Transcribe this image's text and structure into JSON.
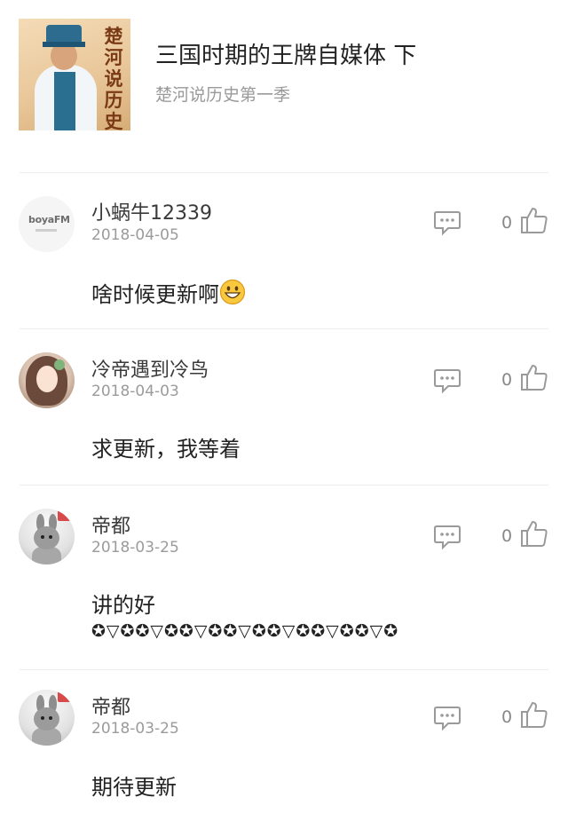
{
  "header": {
    "cover_title": "楚河说历史",
    "title": "三国时期的王牌自媒体 下",
    "subtitle": "楚河说历史第一季"
  },
  "comments": [
    {
      "username": "小蜗牛12339",
      "date": "2018-04-05",
      "text": "啥时候更新啊",
      "text_emoji": "grinning-face-emoji",
      "likes": "0",
      "avatar": "bojia-fm-logo",
      "avatar_brand": "boyaFM",
      "avatar_brand_sub": "运营大咖"
    },
    {
      "username": "冷帝遇到冷鸟",
      "date": "2018-04-03",
      "text": "求更新，我等着",
      "likes": "0",
      "avatar": "anime-girl-avatar"
    },
    {
      "username": "帝都",
      "date": "2018-03-25",
      "text": "讲的好",
      "text_line2": "✪▽✪✪▽✪✪▽✪✪▽✪✪▽✪✪▽✪✪▽✪",
      "likes": "0",
      "avatar": "bunny-doll-avatar"
    },
    {
      "username": "帝都",
      "date": "2018-03-25",
      "text": "期待更新",
      "likes": "0",
      "avatar": "bunny-doll-avatar"
    }
  ],
  "icons": {
    "reply": "comment-bubble-icon",
    "like": "thumbs-up-icon"
  },
  "colors": {
    "text_primary": "#222222",
    "text_secondary": "#9b9b9b",
    "icon_gray": "#9a9a9a",
    "divider": "#ececec"
  }
}
